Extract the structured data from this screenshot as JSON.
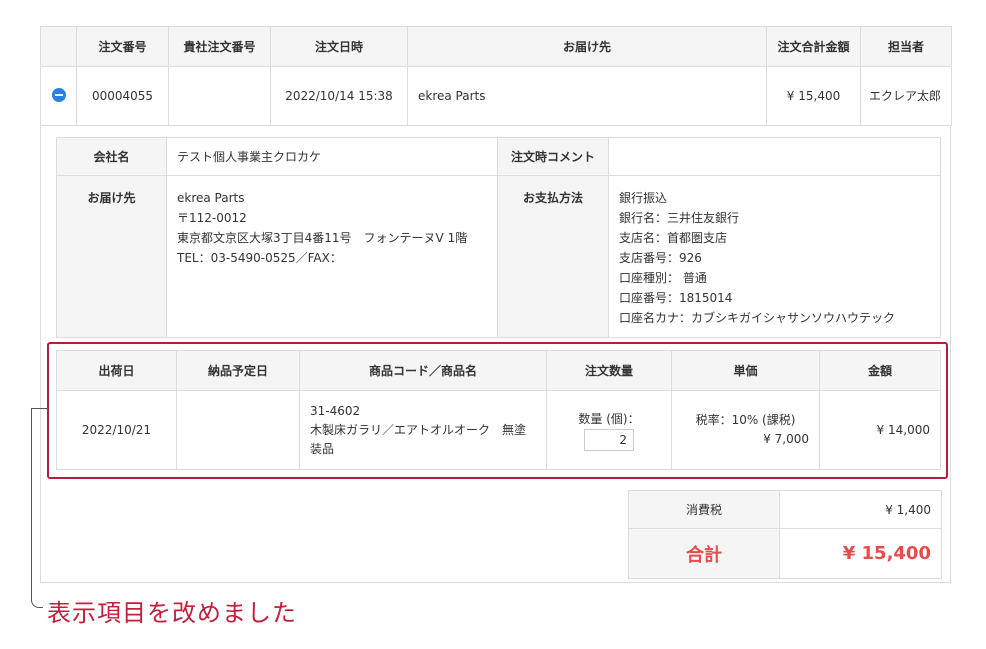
{
  "order": {
    "headers": [
      "",
      "注文番号",
      "貴社注文番号",
      "注文日時",
      "お届け先",
      "注文合計金額",
      "担当者"
    ],
    "row": {
      "order_no": "00004055",
      "customer_order_no": "",
      "date": "2022/10/14 15:38",
      "destination": "ekrea Parts",
      "total": "¥ 15,400",
      "staff": "エクレア太郎"
    }
  },
  "info": {
    "company_label": "会社名",
    "company_value": "テスト個人事業主クロカケ",
    "comment_label": "注文時コメント",
    "comment_value": "",
    "dest_label": "お届け先",
    "dest_lines": [
      "ekrea Parts",
      "〒112-0012",
      "東京都文京区大塚3丁目4番11号　フォンテーヌV 1階",
      "TEL：03-5490-0525／FAX："
    ],
    "pay_label": "お支払方法",
    "pay_lines": [
      "銀行振込",
      "銀行名：三井住友銀行",
      "支店名：首都圏支店",
      "支店番号：926",
      "口座種別： 普通",
      "口座番号：1815014",
      "口座名カナ：カブシキガイシャサンソウハウテック"
    ]
  },
  "items": {
    "headers": [
      "出荷日",
      "納品予定日",
      "商品コード／商品名",
      "注文数量",
      "単価",
      "金額"
    ],
    "row": {
      "ship_date": "2022/10/21",
      "delivery_date": "",
      "code": "31-4602",
      "name": "木製床ガラリ／エアトオルオーク　無塗装品",
      "qty_label": "数量 (個)：",
      "qty": "2",
      "tax": "税率：10% (課税)",
      "unit_price": "¥ 7,000",
      "amount": "¥ 14,000"
    }
  },
  "totals": {
    "tax_label": "消費税",
    "tax_value": "¥ 1,400",
    "total_label": "合計",
    "total_value": "¥ 15,400"
  },
  "annotation": "表示項目を改めました"
}
